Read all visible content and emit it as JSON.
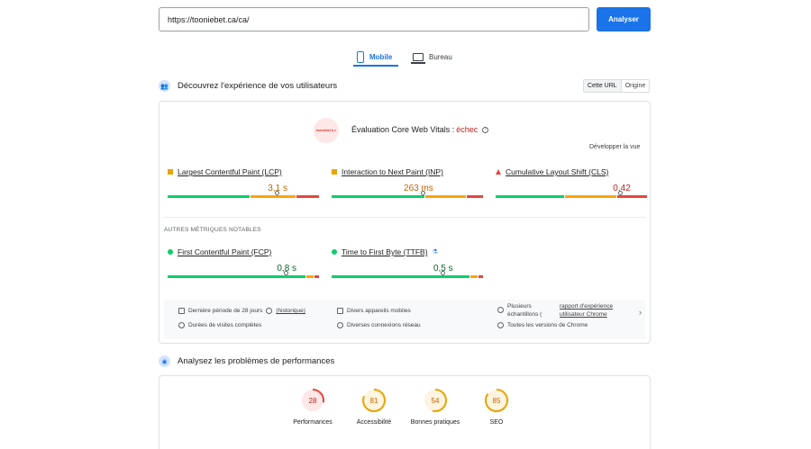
{
  "search": {
    "url": "https://tooniebet.ca/ca/",
    "button": "Analyser"
  },
  "tabs": {
    "mobile": "Mobile",
    "desktop": "Bureau"
  },
  "experience": {
    "title": "Découvrez l'expérience de vos utilisateurs",
    "toggle": [
      "Cette URL",
      "Origine"
    ]
  },
  "cwv": {
    "logo_text": "tooniebet ♣ ♦",
    "title": "Évaluation Core Web Vitals :",
    "status": "échec",
    "expand": "Développer la vue",
    "metrics": [
      {
        "name": "Largest Contentful Paint (LCP)",
        "value": "3,1 s",
        "color": "#e8a400",
        "shape": "square",
        "marker": 0.72,
        "segments": [
          0.55,
          0.3,
          0.15
        ]
      },
      {
        "name": "Interaction to Next Paint (INP)",
        "value": "263 ms",
        "color": "#e8a400",
        "shape": "square",
        "marker": 0.6,
        "segments": [
          0.62,
          0.27,
          0.11
        ]
      },
      {
        "name": "Cumulative Layout Shift (CLS)",
        "value": "0,42",
        "color": "#e8453c",
        "shape": "triangle",
        "marker": 0.82,
        "segments": [
          0.46,
          0.34,
          0.2
        ]
      }
    ],
    "notable_heading": "AUTRES MÉTRIQUES NOTABLES",
    "notable": [
      {
        "name": "First Contentful Paint (FCP)",
        "value": "0,8 s",
        "color": "#0cce6b",
        "marker": 0.78,
        "segments": [
          0.92,
          0.05,
          0.03
        ]
      },
      {
        "name": "Time to First Byte (TTFB)",
        "value": "0,5 s",
        "color": "#0cce6b",
        "marker": 0.73,
        "segments": [
          0.92,
          0.05,
          0.03
        ]
      }
    ],
    "info": {
      "period": "Dernière période de 28 jours",
      "history": "(historique)",
      "durations": "Durées de visites complètes",
      "devices": "Divers appareils mobiles",
      "network": "Diverses connexions réseau",
      "samples": "Plusieurs échantillons (",
      "report_link_1": "rapport d'expérience",
      "report_link_2": "utilisateur Chrome",
      "chrome": "Toutes les versions de Chrome",
      "chevron": "›"
    }
  },
  "performance": {
    "title": "Analysez les problèmes de performances",
    "scores": [
      {
        "label": "Performances",
        "value": "28",
        "color": "#e8453c",
        "bg": "#fde7e7"
      },
      {
        "label": "Accessibilité",
        "value": "81",
        "color": "#e8a400",
        "bg": "#fef4e0"
      },
      {
        "label": "Bonnes pratiques",
        "value": "54",
        "color": "#e8a400",
        "bg": "#fef4e0"
      },
      {
        "label": "SEO",
        "value": "85",
        "color": "#e8a400",
        "bg": "#fef4e0"
      }
    ]
  },
  "colors": {
    "good": "#0cce6b",
    "average": "#ffa400",
    "poor": "#e8453c",
    "accent": "#1a73e8"
  }
}
